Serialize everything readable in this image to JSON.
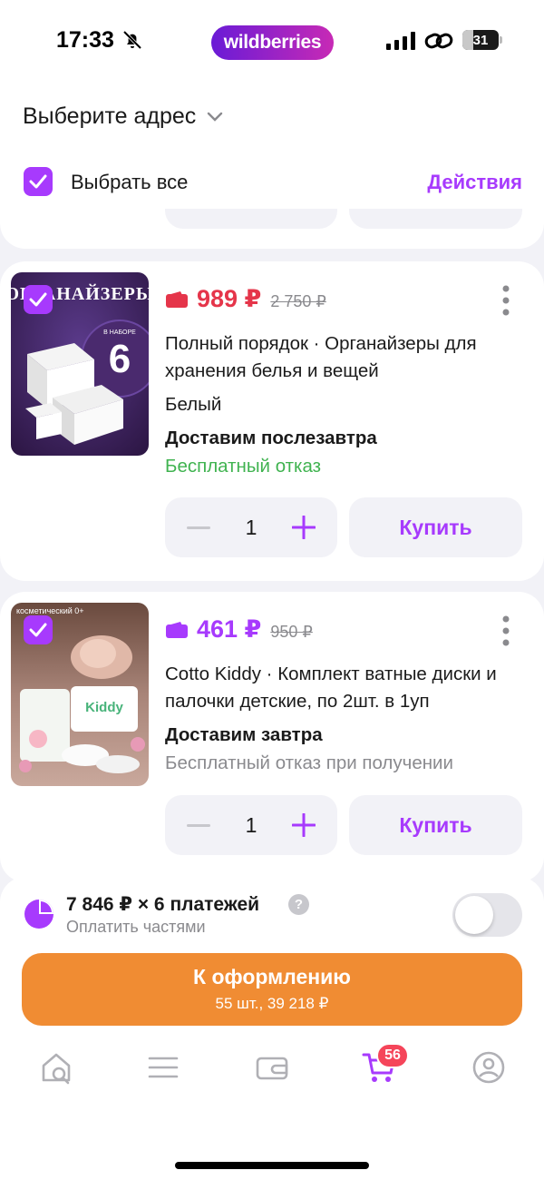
{
  "status_bar": {
    "time": "17:33",
    "brand": "wildberries",
    "battery": "31",
    "battery_level": 0.31
  },
  "header": {
    "address_label": "Выберите адрес",
    "select_all_label": "Выбрать все",
    "select_all_checked": true,
    "actions_label": "Действия"
  },
  "products": [
    {
      "checked": true,
      "price": "989 ₽",
      "price_color": "#e5354a",
      "old_price": "2 750 ₽",
      "title": "Полный порядок · Органайзеры для хранения белья и вещей",
      "color": "Белый",
      "delivery": "Доставим послезавтра",
      "refund": "Бесплатный отказ",
      "refund_color": "#40b350",
      "quantity": "1",
      "buy_label": "Купить",
      "image_text_main": "ОРГАНАЙЗЕРЫ",
      "image_text_count": "6",
      "image_text_set": "В НАБОРЕ"
    },
    {
      "checked": true,
      "price": "461 ₽",
      "price_color": "#a73afd",
      "old_price": "950 ₽",
      "title": "Cotto Kiddy · Комплект ватные диски и палочки детские, по 2шт. в 1уп",
      "delivery": "Доставим завтра",
      "refund": "Бесплатный отказ при получении",
      "refund_color": "#8a8a8e",
      "quantity": "1",
      "buy_label": "Купить",
      "image_text_top": "косметический 0+",
      "image_text_brand": "Kiddy"
    }
  ],
  "installment": {
    "amount": "7 846 ₽ × 6 платежей",
    "subtitle": "Оплатить частями",
    "help": "?",
    "enabled": false
  },
  "checkout": {
    "label": "К оформлению",
    "summary": "55 шт., 39 218 ₽"
  },
  "tab_bar": {
    "items": [
      "home-search-icon",
      "menu-icon",
      "wallet-icon",
      "cart-icon",
      "profile-icon"
    ],
    "active": "cart-icon",
    "cart_badge": "56"
  },
  "colors": {
    "accent": "#a73afd",
    "checkout": "#f08c33",
    "badge": "#f5455a"
  }
}
